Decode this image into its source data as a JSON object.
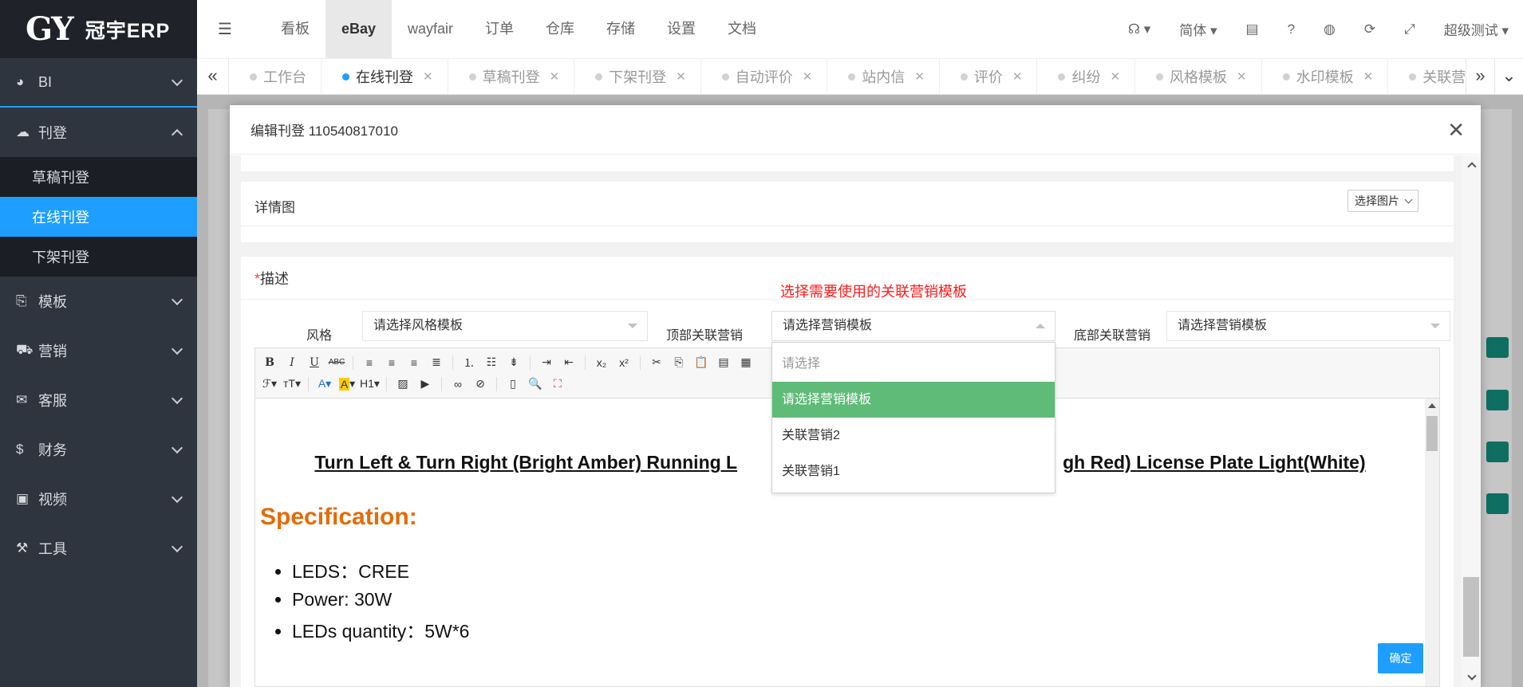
{
  "app": {
    "logo_mark": "GY",
    "brand": "冠宇ERP"
  },
  "sidebar": {
    "items": [
      {
        "label": "BI"
      },
      {
        "label": "刊登"
      },
      {
        "label": "模板"
      },
      {
        "label": "营销"
      },
      {
        "label": "客服"
      },
      {
        "label": "财务"
      },
      {
        "label": "视频"
      },
      {
        "label": "工具"
      }
    ],
    "sub_items": [
      {
        "label": "草稿刊登"
      },
      {
        "label": "在线刊登"
      },
      {
        "label": "下架刊登"
      }
    ]
  },
  "top_menu": {
    "items": [
      "看板",
      "eBay",
      "wayfair",
      "订单",
      "仓库",
      "存储",
      "设置",
      "文档"
    ],
    "active": "eBay",
    "language": "简体",
    "user": "超级测试"
  },
  "tabs": {
    "items": [
      "工作台",
      "在线刊登",
      "草稿刊登",
      "下架刊登",
      "自动评价",
      "站内信",
      "评价",
      "纠纷",
      "风格模板",
      "水印模板",
      "关联营"
    ],
    "active": "在线刊登"
  },
  "modal": {
    "title": "编辑刊登 110540817010",
    "detail_label": "详情图",
    "select_image_button": "选择图片",
    "desc_required_mark": "*",
    "desc_label": "描述",
    "hint": "选择需要使用的关联营销模板",
    "style_label": "风格",
    "style_value": "请选择风格模板",
    "top_label": "顶部关联营销",
    "top_value": "请选择营销模板",
    "bottom_label": "底部关联营销",
    "bottom_value": "请选择营销模板",
    "dropdown": {
      "placeholder": "请选择",
      "options": [
        "请选择营销模板",
        "关联营销2",
        "关联营销1"
      ],
      "selected": "请选择营销模板"
    },
    "editor": {
      "headline_parts": [
        "Turn Left & Turn Right (Bright Amber)",
        "Running L",
        "gh Red)",
        "License Plate Light(White)"
      ],
      "spec_heading": "Specification:",
      "spec_items": [
        "LEDS：CREE",
        "Power: 30W",
        "LEDs quantity：5W*6"
      ]
    },
    "confirm_button": "确定"
  },
  "colors": {
    "accent": "#1e9fff",
    "sidebar_bg": "#2f353e",
    "hint_red": "#ff1a1a",
    "spec_orange": "#e36c09",
    "selected_green": "#5fbb78"
  }
}
